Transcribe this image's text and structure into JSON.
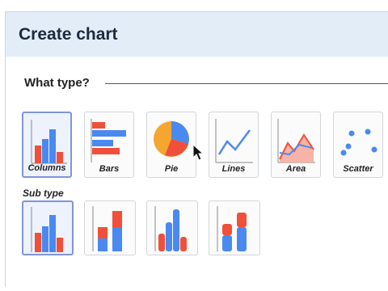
{
  "dialog": {
    "title": "Create chart"
  },
  "type_section": {
    "title": "What type?"
  },
  "chart_types": [
    {
      "label": "Columns",
      "icon": "columns-chart-icon",
      "selected": true
    },
    {
      "label": "Bars",
      "icon": "bars-chart-icon",
      "selected": false
    },
    {
      "label": "Pie",
      "icon": "pie-chart-icon",
      "selected": false
    },
    {
      "label": "Lines",
      "icon": "lines-chart-icon",
      "selected": false
    },
    {
      "label": "Area",
      "icon": "area-chart-icon",
      "selected": false
    },
    {
      "label": "Scatter",
      "icon": "scatter-chart-icon",
      "selected": false
    }
  ],
  "sub_type": {
    "title": "Sub type",
    "options": [
      {
        "icon": "clustered-columns-icon",
        "selected": true
      },
      {
        "icon": "stacked-columns-icon",
        "selected": false
      },
      {
        "icon": "3d-columns-icon",
        "selected": false
      },
      {
        "icon": "3d-stacked-columns-icon",
        "selected": false
      }
    ]
  },
  "colors": {
    "blue": "#4a8af0",
    "red": "#f0503a",
    "orange": "#f4a630",
    "accent": "#7f95d6"
  }
}
